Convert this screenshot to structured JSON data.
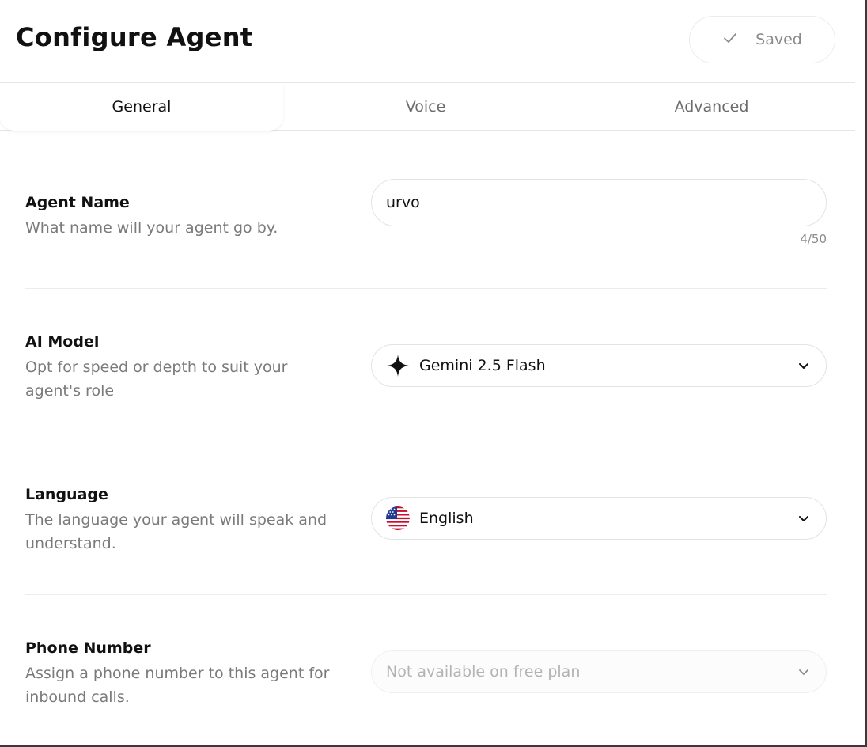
{
  "header": {
    "title": "Configure Agent",
    "saved_label": "Saved"
  },
  "tabs": [
    {
      "label": "General",
      "active": true
    },
    {
      "label": "Voice",
      "active": false
    },
    {
      "label": "Advanced",
      "active": false
    }
  ],
  "agent_name": {
    "label": "Agent Name",
    "description": "What name will your agent go by.",
    "value": "urvo",
    "counter": "4/50"
  },
  "ai_model": {
    "label": "AI Model",
    "description": "Opt for speed or depth to suit your agent's role",
    "selected": "Gemini 2.5 Flash",
    "icon": "sparkle-icon"
  },
  "language": {
    "label": "Language",
    "description": "The language your agent will speak and understand.",
    "selected": "English",
    "icon": "us-flag-icon"
  },
  "phone_number": {
    "label": "Phone Number",
    "description": "Assign a phone number to this agent for inbound calls.",
    "placeholder": "Not available on free plan",
    "disabled": true
  },
  "colors": {
    "text": "#111111",
    "muted": "#7a7a7a",
    "border": "#e3e3e3"
  }
}
